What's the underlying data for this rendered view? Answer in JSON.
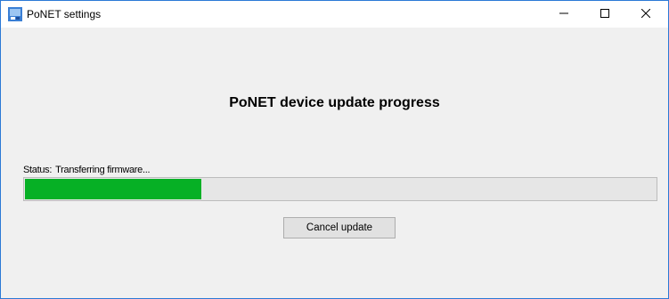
{
  "window": {
    "title": "PoNET settings",
    "icon": "ponet-app-icon",
    "controls": [
      "minimize-icon",
      "maximize-icon",
      "close-icon"
    ]
  },
  "main": {
    "heading": "PoNET device update progress",
    "status_prefix": "Status:",
    "status_text": "Transferring firmware...",
    "progress_fraction": 0.28,
    "cancel_label": "Cancel update"
  },
  "colors": {
    "progress_fill": "#06b025",
    "progress_track": "#e6e6e6",
    "window_border": "#2b79d6",
    "icon_blue": "#3a7fd5"
  }
}
